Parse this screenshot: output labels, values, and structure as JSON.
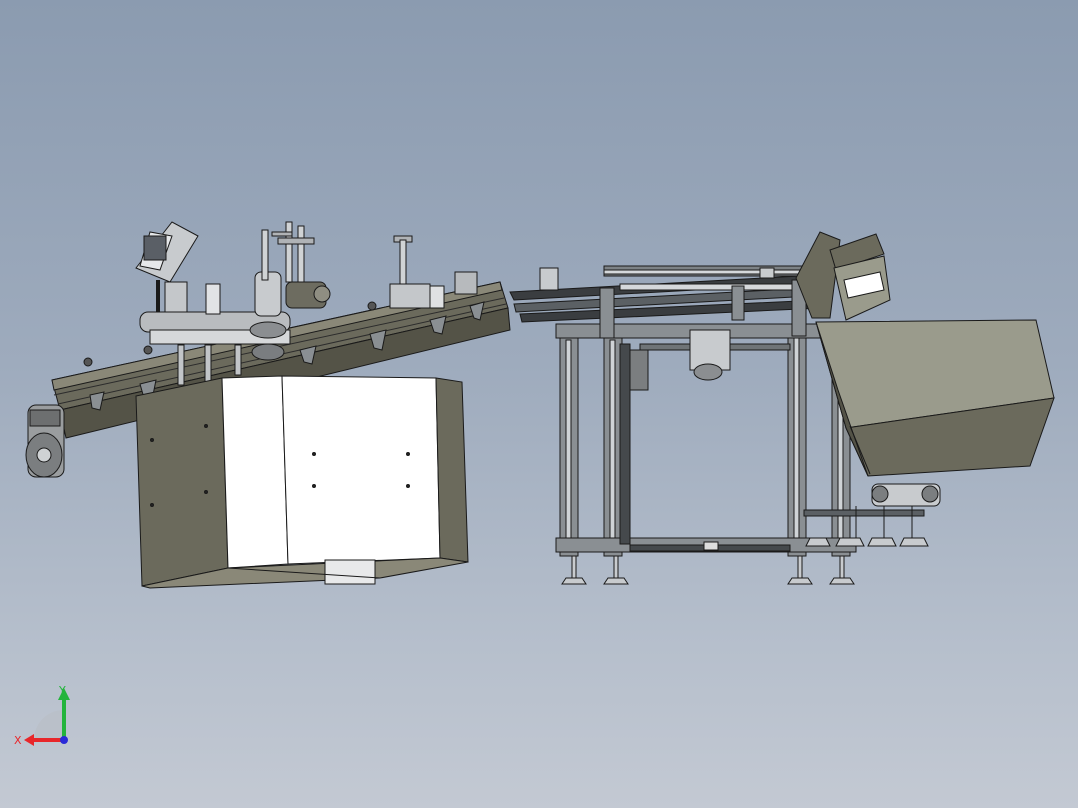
{
  "viewport": {
    "background_top": "#8b9bb0",
    "background_bottom": "#c3c9d3",
    "model_line_color": "#1a1a1a",
    "body_fill": "#6b6a5c",
    "panel_fill": "#ffffff",
    "frame_fill": "#8a8f93"
  },
  "triad": {
    "x_label": "X",
    "y_label": "Y",
    "x_color": "#e8262a",
    "y_color": "#23b43c",
    "z_color": "#2a2ad8"
  }
}
